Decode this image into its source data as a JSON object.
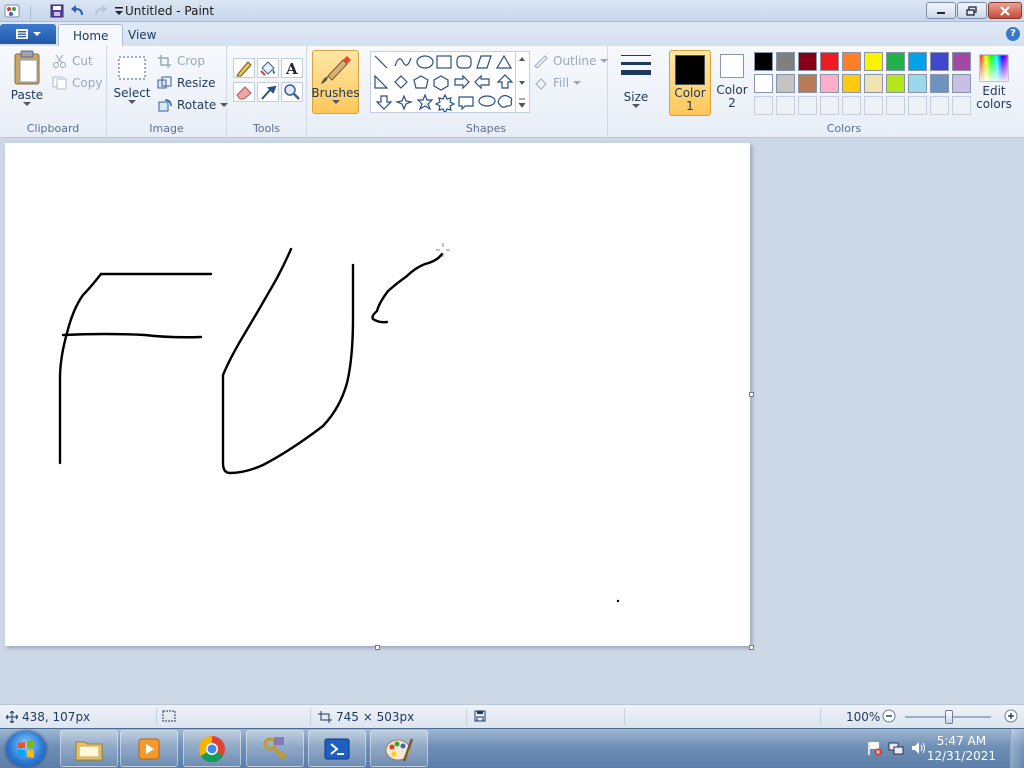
{
  "window": {
    "title": "Untitled - Paint"
  },
  "tabs": [
    {
      "label": "Home"
    },
    {
      "label": "View"
    }
  ],
  "clipboard": {
    "label": "Clipboard",
    "paste": "Paste",
    "cut": "Cut",
    "copy": "Copy"
  },
  "image": {
    "label": "Image",
    "select": "Select",
    "crop": "Crop",
    "resize": "Resize",
    "rotate": "Rotate"
  },
  "tools": {
    "label": "Tools"
  },
  "brushes": {
    "label": "Brushes"
  },
  "shapes": {
    "label": "Shapes",
    "outline": "Outline",
    "fill": "Fill"
  },
  "size": {
    "label": "Size"
  },
  "colors": {
    "label": "Colors",
    "color1": "Color 1",
    "color1_line1": "Color",
    "color1_line2": "1",
    "color2_line1": "Color",
    "color2_line2": "2",
    "edit": "Edit colors",
    "edit_line1": "Edit",
    "edit_line2": "colors",
    "color1_value": "#000000",
    "color2_value": "#ffffff",
    "palette_row1": [
      "#000000",
      "#7f7f7f",
      "#880015",
      "#ed1c24",
      "#ff7f27",
      "#fff200",
      "#22b14c",
      "#00a2e8",
      "#3f48cc",
      "#a349a4"
    ],
    "palette_row2": [
      "#ffffff",
      "#c3c3c3",
      "#b97a57",
      "#ffaec9",
      "#ffc90e",
      "#efe4b0",
      "#b5e61d",
      "#99d9ea",
      "#7092be",
      "#c8bfe7"
    ]
  },
  "status": {
    "cursor_pos": "438, 107px",
    "canvas_size": "745 × 503px",
    "zoom": "100%"
  },
  "taskbar": {
    "time": "5:47 AM",
    "date": "12/31/2021",
    "items": [
      "explorer-icon",
      "media-player-icon",
      "chrome-icon",
      "keys-app-icon",
      "powershell-icon",
      "paint-icon"
    ]
  }
}
